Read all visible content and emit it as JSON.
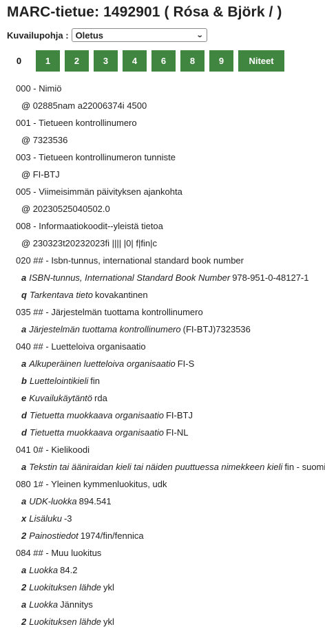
{
  "title": "MARC-tietue: 1492901 ( Rósa & Björk / )",
  "view": {
    "label": "Kuvailupohja :",
    "selected": "Oletus"
  },
  "tabs": [
    {
      "label": "0",
      "active": true
    },
    {
      "label": "1"
    },
    {
      "label": "2"
    },
    {
      "label": "3"
    },
    {
      "label": "4"
    },
    {
      "label": "6"
    },
    {
      "label": "8"
    },
    {
      "label": "9"
    },
    {
      "label": "Niteet"
    }
  ],
  "fields": [
    {
      "tag": "000 - Nimiö",
      "subfields": [
        {
          "code": "@",
          "desc": "",
          "value": "02885nam a22006374i 4500"
        }
      ]
    },
    {
      "tag": "001 - Tietueen kontrollinumero",
      "subfields": [
        {
          "code": "@",
          "desc": "",
          "value": "7323536"
        }
      ]
    },
    {
      "tag": "003 - Tietueen kontrollinumeron tunniste",
      "subfields": [
        {
          "code": "@",
          "desc": "",
          "value": "FI-BTJ"
        }
      ]
    },
    {
      "tag": "005 - Viimeisimmän päivityksen ajankohta",
      "subfields": [
        {
          "code": "@",
          "desc": "",
          "value": "20230525040502.0"
        }
      ]
    },
    {
      "tag": "008 - Informaatiokoodit--yleistä tietoa",
      "subfields": [
        {
          "code": "@",
          "desc": "",
          "value": "230323t20232023fi |||| |0| f|fin|c"
        }
      ]
    },
    {
      "tag": "020 ## - Isbn-tunnus, international standard book number",
      "subfields": [
        {
          "code": "a",
          "desc": "ISBN-tunnus, International Standard Book Number",
          "value": "978-951-0-48127-1"
        },
        {
          "code": "q",
          "desc": "Tarkentava tieto",
          "value": "kovakantinen"
        }
      ]
    },
    {
      "tag": "035 ## - Järjestelmän tuottama kontrollinumero",
      "subfields": [
        {
          "code": "a",
          "desc": "Järjestelmän tuottama kontrollinumero",
          "value": "(FI-BTJ)7323536"
        }
      ]
    },
    {
      "tag": "040 ## - Luetteloiva organisaatio",
      "subfields": [
        {
          "code": "a",
          "desc": "Alkuperäinen luetteloiva organisaatio",
          "value": "FI-S"
        },
        {
          "code": "b",
          "desc": "Luettelointikieli",
          "value": "fin"
        },
        {
          "code": "e",
          "desc": "Kuvailukäytäntö",
          "value": "rda"
        },
        {
          "code": "d",
          "desc": "Tietuetta muokkaava organisaatio",
          "value": "FI-BTJ"
        },
        {
          "code": "d",
          "desc": "Tietuetta muokkaava organisaatio",
          "value": "FI-NL"
        }
      ]
    },
    {
      "tag": "041 0# - Kielikoodi",
      "subfields": [
        {
          "code": "a",
          "desc": "Tekstin tai ääniraidan kieli tai näiden puuttuessa nimekkeen kieli",
          "value": "fin - suomi"
        }
      ]
    },
    {
      "tag": "080 1# - Yleinen kymmenluokitus, udk",
      "subfields": [
        {
          "code": "a",
          "desc": "UDK-luokka",
          "value": "894.541"
        },
        {
          "code": "x",
          "desc": "Lisäluku",
          "value": "-3"
        },
        {
          "code": "2",
          "desc": "Painostiedot",
          "value": "1974/fin/fennica"
        }
      ]
    },
    {
      "tag": "084 ## - Muu luokitus",
      "subfields": [
        {
          "code": "a",
          "desc": "Luokka",
          "value": "84.2"
        },
        {
          "code": "2",
          "desc": "Luokituksen lähde",
          "value": "ykl"
        },
        {
          "code": "a",
          "desc": "Luokka",
          "value": "Jännitys"
        },
        {
          "code": "2",
          "desc": "Luokituksen lähde",
          "value": "ykl"
        }
      ]
    }
  ]
}
